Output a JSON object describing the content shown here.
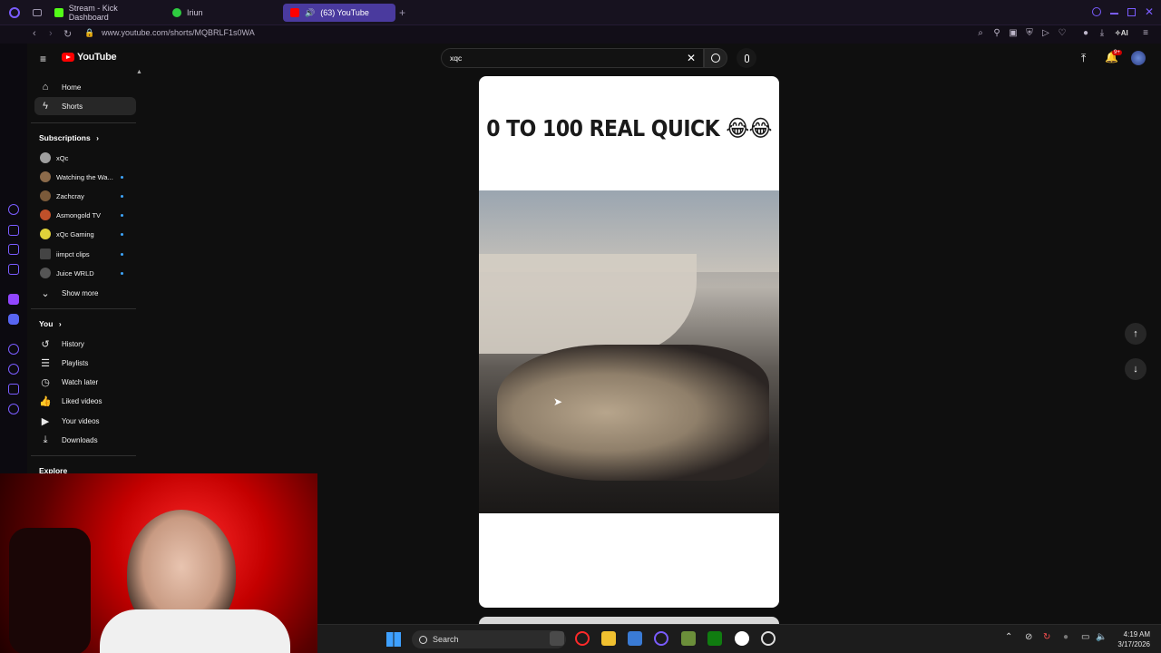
{
  "browser": {
    "tabs": [
      {
        "label": "Stream - Kick Dashboard",
        "color": "#53fc18",
        "active": false
      },
      {
        "label": "Iriun",
        "color": "#2ecc40",
        "active": false
      },
      {
        "label": "(63) YouTube",
        "color": "#ff0000",
        "active": true
      }
    ],
    "url": "www.youtube.com/shorts/MQBRLF1s0WA",
    "ai_label": "AI"
  },
  "youtube": {
    "logo_text": "YouTube",
    "search_value": "xqc",
    "notification_badge": "9+",
    "sidebar": {
      "main": [
        {
          "label": "Home",
          "icon": "home-icon",
          "selected": false
        },
        {
          "label": "Shorts",
          "icon": "shorts-icon",
          "selected": true
        }
      ],
      "subscriptions_title": "Subscriptions",
      "subscriptions": [
        {
          "label": "xQc",
          "color": "#9e9e9e"
        },
        {
          "label": "Watching the Wa...",
          "color": "#8b6a4a"
        },
        {
          "label": "Zachcray",
          "color": "#7a5a3a"
        },
        {
          "label": "Asmongold TV",
          "color": "#c0502a"
        },
        {
          "label": "xQc Gaming",
          "color": "#e0d23a"
        },
        {
          "label": "iimpct clips",
          "color": "#444444"
        },
        {
          "label": "Juice WRLD",
          "color": "#555555"
        }
      ],
      "show_more": "Show more",
      "you_title": "You",
      "you": [
        {
          "label": "History",
          "icon": "history-icon"
        },
        {
          "label": "Playlists",
          "icon": "playlists-icon"
        },
        {
          "label": "Watch later",
          "icon": "watch-later-icon"
        },
        {
          "label": "Liked videos",
          "icon": "liked-icon"
        },
        {
          "label": "Your videos",
          "icon": "your-videos-icon"
        },
        {
          "label": "Downloads",
          "icon": "download-icon"
        }
      ],
      "explore_title": "Explore"
    },
    "short": {
      "caption": "0 TO 100 REAL QUICK 😂😂"
    }
  },
  "taskbar": {
    "search_label": "Search",
    "time": "4:19 AM",
    "date": "3/17/2026"
  }
}
